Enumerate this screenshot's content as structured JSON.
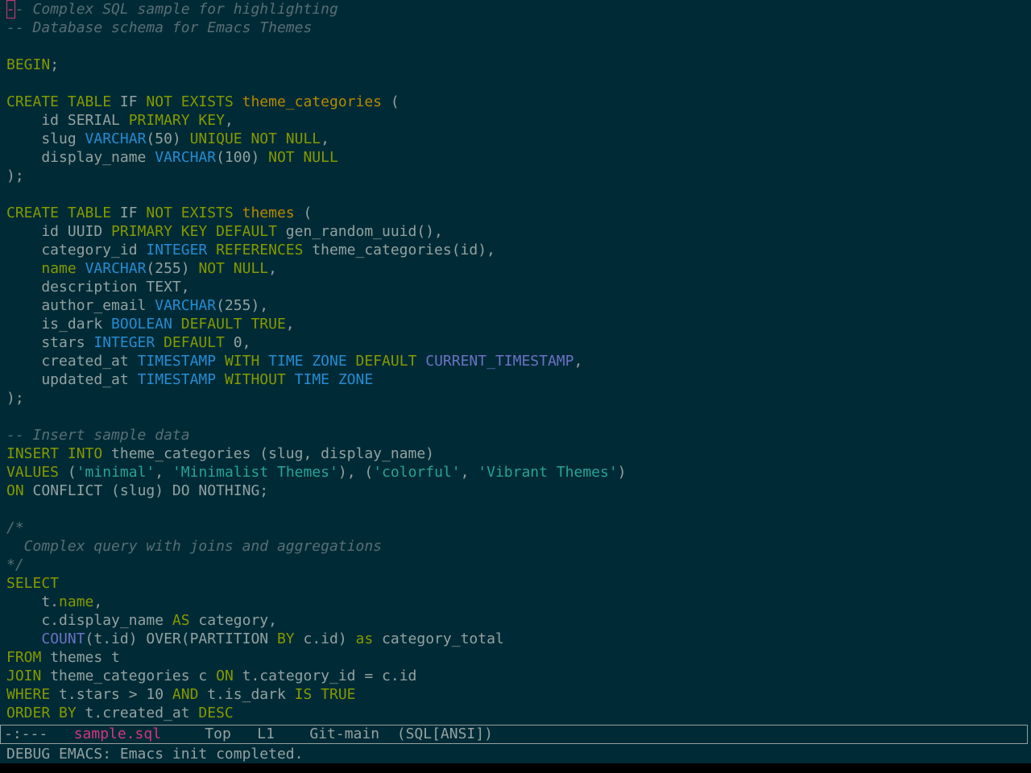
{
  "buffer": {
    "name": "sample.sql",
    "cursor_line": 0,
    "cursor_col": 0
  },
  "colors": {
    "background": "#002b36",
    "default": "#93a1a1",
    "keyword": "#859900",
    "comment": "#586e75",
    "type": "#268bd2",
    "table": "#b58900",
    "string": "#2aa198",
    "function": "#6c71c4",
    "cursor": "#d33682",
    "buffer_name": "#d33682"
  },
  "lines": [
    [
      [
        "comment",
        "-- Complex SQL sample for highlighting"
      ]
    ],
    [
      [
        "comment",
        "-- Database schema for Emacs Themes"
      ]
    ],
    [],
    [
      [
        "keyword",
        "BEGIN"
      ],
      [
        "default",
        ";"
      ]
    ],
    [],
    [
      [
        "keyword",
        "CREATE TABLE"
      ],
      [
        "default",
        " IF "
      ],
      [
        "keyword",
        "NOT EXISTS"
      ],
      [
        "default",
        " "
      ],
      [
        "table",
        "theme_categories"
      ],
      [
        "default",
        " ("
      ]
    ],
    [
      [
        "default",
        "    id SERIAL "
      ],
      [
        "keyword",
        "PRIMARY KEY"
      ],
      [
        "default",
        ","
      ]
    ],
    [
      [
        "default",
        "    slug "
      ],
      [
        "type",
        "VARCHAR"
      ],
      [
        "default",
        "(50) "
      ],
      [
        "keyword",
        "UNIQUE NOT NULL"
      ],
      [
        "default",
        ","
      ]
    ],
    [
      [
        "default",
        "    display_name "
      ],
      [
        "type",
        "VARCHAR"
      ],
      [
        "default",
        "(100) "
      ],
      [
        "keyword",
        "NOT NULL"
      ]
    ],
    [
      [
        "default",
        ");"
      ]
    ],
    [],
    [
      [
        "keyword",
        "CREATE TABLE"
      ],
      [
        "default",
        " IF "
      ],
      [
        "keyword",
        "NOT EXISTS"
      ],
      [
        "default",
        " "
      ],
      [
        "table",
        "themes"
      ],
      [
        "default",
        " ("
      ]
    ],
    [
      [
        "default",
        "    id UUID "
      ],
      [
        "keyword",
        "PRIMARY KEY DEFAULT"
      ],
      [
        "default",
        " gen_random_uuid(),"
      ]
    ],
    [
      [
        "default",
        "    category_id "
      ],
      [
        "type",
        "INTEGER"
      ],
      [
        "default",
        " "
      ],
      [
        "keyword",
        "REFERENCES"
      ],
      [
        "default",
        " theme_categories(id),"
      ]
    ],
    [
      [
        "default",
        "    "
      ],
      [
        "keyword",
        "name"
      ],
      [
        "default",
        " "
      ],
      [
        "type",
        "VARCHAR"
      ],
      [
        "default",
        "(255) "
      ],
      [
        "keyword",
        "NOT NULL"
      ],
      [
        "default",
        ","
      ]
    ],
    [
      [
        "default",
        "    description TEXT,"
      ]
    ],
    [
      [
        "default",
        "    author_email "
      ],
      [
        "type",
        "VARCHAR"
      ],
      [
        "default",
        "(255),"
      ]
    ],
    [
      [
        "default",
        "    is_dark "
      ],
      [
        "type",
        "BOOLEAN"
      ],
      [
        "default",
        " "
      ],
      [
        "keyword",
        "DEFAULT TRUE"
      ],
      [
        "default",
        ","
      ]
    ],
    [
      [
        "default",
        "    stars "
      ],
      [
        "type",
        "INTEGER"
      ],
      [
        "default",
        " "
      ],
      [
        "keyword",
        "DEFAULT"
      ],
      [
        "default",
        " 0,"
      ]
    ],
    [
      [
        "default",
        "    created_at "
      ],
      [
        "type",
        "TIMESTAMP"
      ],
      [
        "default",
        " "
      ],
      [
        "keyword",
        "WITH"
      ],
      [
        "default",
        " "
      ],
      [
        "type",
        "TIME ZONE"
      ],
      [
        "default",
        " "
      ],
      [
        "keyword",
        "DEFAULT"
      ],
      [
        "default",
        " "
      ],
      [
        "function",
        "CURRENT_TIMESTAMP"
      ],
      [
        "default",
        ","
      ]
    ],
    [
      [
        "default",
        "    updated_at "
      ],
      [
        "type",
        "TIMESTAMP"
      ],
      [
        "default",
        " "
      ],
      [
        "keyword",
        "WITHOUT"
      ],
      [
        "default",
        " "
      ],
      [
        "type",
        "TIME ZONE"
      ]
    ],
    [
      [
        "default",
        ");"
      ]
    ],
    [],
    [
      [
        "comment",
        "-- Insert sample data"
      ]
    ],
    [
      [
        "keyword",
        "INSERT INTO"
      ],
      [
        "default",
        " theme_categories (slug, display_name)"
      ]
    ],
    [
      [
        "keyword",
        "VALUES"
      ],
      [
        "default",
        " ("
      ],
      [
        "string",
        "'minimal'"
      ],
      [
        "default",
        ", "
      ],
      [
        "string",
        "'Minimalist Themes'"
      ],
      [
        "default",
        "), ("
      ],
      [
        "string",
        "'colorful'"
      ],
      [
        "default",
        ", "
      ],
      [
        "string",
        "'Vibrant Themes'"
      ],
      [
        "default",
        ")"
      ]
    ],
    [
      [
        "keyword",
        "ON"
      ],
      [
        "default",
        " CONFLICT (slug) DO NOTHING;"
      ]
    ],
    [],
    [
      [
        "comment",
        "/*"
      ]
    ],
    [
      [
        "comment",
        "  Complex query with joins and aggregations"
      ]
    ],
    [
      [
        "comment",
        "*/"
      ]
    ],
    [
      [
        "keyword",
        "SELECT"
      ]
    ],
    [
      [
        "default",
        "    t."
      ],
      [
        "keyword",
        "name"
      ],
      [
        "default",
        ","
      ]
    ],
    [
      [
        "default",
        "    c.display_name "
      ],
      [
        "keyword",
        "AS"
      ],
      [
        "default",
        " category,"
      ]
    ],
    [
      [
        "default",
        "    "
      ],
      [
        "function",
        "COUNT"
      ],
      [
        "default",
        "(t.id) OVER(PARTITION "
      ],
      [
        "keyword",
        "BY"
      ],
      [
        "default",
        " c.id) "
      ],
      [
        "keyword",
        "as"
      ],
      [
        "default",
        " category_total"
      ]
    ],
    [
      [
        "keyword",
        "FROM"
      ],
      [
        "default",
        " themes t"
      ]
    ],
    [
      [
        "keyword",
        "JOIN"
      ],
      [
        "default",
        " theme_categories c "
      ],
      [
        "keyword",
        "ON"
      ],
      [
        "default",
        " t.category_id = c.id"
      ]
    ],
    [
      [
        "keyword",
        "WHERE"
      ],
      [
        "default",
        " t.stars > 10 "
      ],
      [
        "keyword",
        "AND"
      ],
      [
        "default",
        " t.is_dark "
      ],
      [
        "keyword",
        "IS TRUE"
      ]
    ],
    [
      [
        "keyword",
        "ORDER BY"
      ],
      [
        "default",
        " t.created_at "
      ],
      [
        "keyword",
        "DESC"
      ]
    ]
  ],
  "modeline": {
    "status": "-:---",
    "buffer_name": "sample.sql",
    "position": "Top",
    "line": "L1",
    "vc": "Git-main",
    "mode": "(SQL[ANSI])"
  },
  "echo_area": {
    "message": "DEBUG EMACS: Emacs init completed."
  }
}
